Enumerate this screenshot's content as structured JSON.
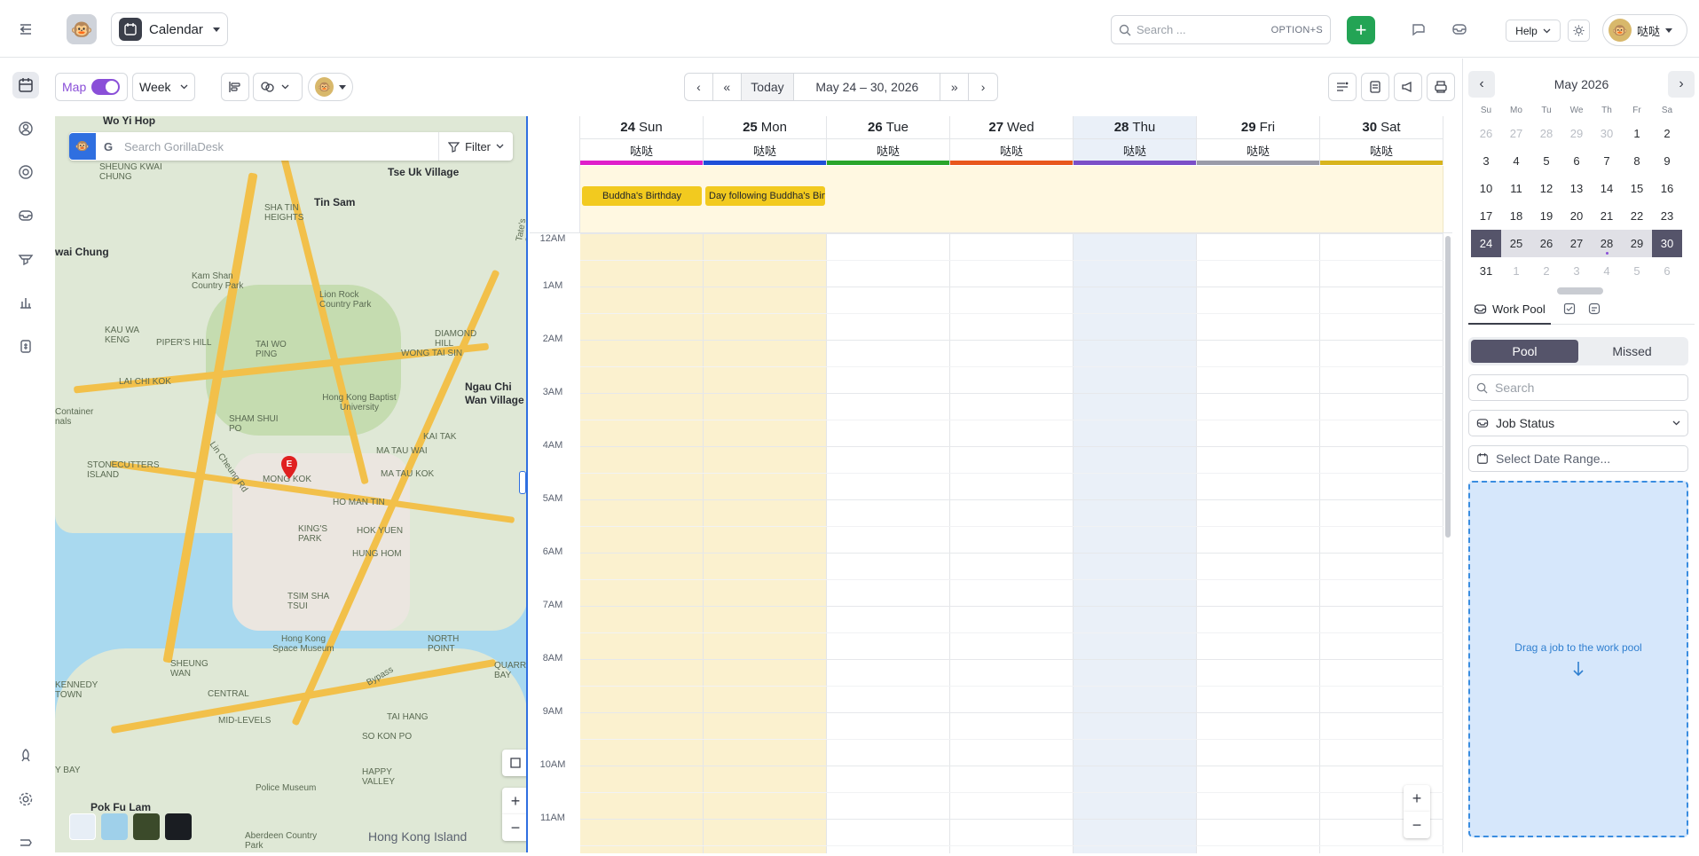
{
  "topbar": {
    "module_label": "Calendar",
    "search_placeholder": "Search ...",
    "search_shortcut": "OPTION+S",
    "help_label": "Help",
    "user_name": "哒哒"
  },
  "toolbar": {
    "map_label": "Map",
    "view_label": "Week",
    "today_label": "Today",
    "date_range": "May 24 – 30, 2026"
  },
  "map": {
    "search_placeholder": "Search GorillaDesk",
    "filter_label": "Filter",
    "pin_label": "E",
    "labels": [
      "Wo Yi Hop",
      "Tse Uk Village",
      "Tin Sam",
      "wai Chung",
      "Ngau Chi Wan Village",
      "Pok Fu Lam",
      "Hong Kong Island",
      "SHEUNG KWAI CHUNG",
      "SHA TIN HEIGHTS",
      "Kam Shan Country Park",
      "Lion Rock Country Park",
      "KAU WA KENG",
      "PIPER'S HILL",
      "TAI WO PING",
      "DIAMOND HILL",
      "WONG TAI SIN",
      "LAI CHI KOK",
      "SHAM SHUI PO",
      "Hong Kong Baptist University",
      "Container nals",
      "MA TAU WAI",
      "KAI TAK",
      "STONECUTTERS ISLAND",
      "Lin Cheung Rd",
      "MONG KOK",
      "HO MAN TIN",
      "MA TAU KOK",
      "KING'S PARK",
      "HOK YUEN",
      "HUNG HOM",
      "TSIM SHA TSUI",
      "Hong Kong Space Museum",
      "SHEUNG WAN",
      "CENTRAL",
      "KENNEDY TOWN",
      "MID-LEVELS",
      "NORTH POINT",
      "QUARRY BAY",
      "TAI HANG",
      "SO KON PO",
      "HAPPY VALLEY",
      "Police Museum",
      "Aberdeen Country Park",
      "Tate's Cairn Tunnel",
      "Bypass",
      "Y BAY"
    ]
  },
  "calendar": {
    "hours": [
      "12AM",
      "1AM",
      "2AM",
      "3AM",
      "4AM",
      "5AM",
      "6AM",
      "7AM",
      "8AM",
      "9AM",
      "10AM",
      "11AM"
    ],
    "days": [
      {
        "num": "24",
        "name": "Sun",
        "tech": "哒哒",
        "color": "#e01ec9"
      },
      {
        "num": "25",
        "name": "Mon",
        "tech": "哒哒",
        "color": "#1e4fd8"
      },
      {
        "num": "26",
        "name": "Tue",
        "tech": "哒哒",
        "color": "#2aa52a"
      },
      {
        "num": "27",
        "name": "Wed",
        "tech": "哒哒",
        "color": "#e8571c"
      },
      {
        "num": "28",
        "name": "Thu",
        "tech": "哒哒",
        "color": "#7b4fc7"
      },
      {
        "num": "29",
        "name": "Fri",
        "tech": "哒哒",
        "color": "#9a9ba8"
      },
      {
        "num": "30",
        "name": "Sat",
        "tech": "哒哒",
        "color": "#d8b41c"
      }
    ],
    "events": [
      {
        "label": "Buddha's Birthday"
      },
      {
        "label": "Day following Buddha's Birthday"
      }
    ]
  },
  "mini_calendar": {
    "title": "May 2026",
    "dow": [
      "Su",
      "Mo",
      "Tu",
      "We",
      "Th",
      "Fr",
      "Sa"
    ],
    "weeks": [
      [
        "26",
        "27",
        "28",
        "29",
        "30",
        "1",
        "2"
      ],
      [
        "3",
        "4",
        "5",
        "6",
        "7",
        "8",
        "9"
      ],
      [
        "10",
        "11",
        "12",
        "13",
        "14",
        "15",
        "16"
      ],
      [
        "17",
        "18",
        "19",
        "20",
        "21",
        "22",
        "23"
      ],
      [
        "24",
        "25",
        "26",
        "27",
        "28",
        "29",
        "30"
      ],
      [
        "31",
        "1",
        "2",
        "3",
        "4",
        "5",
        "6"
      ]
    ]
  },
  "workpool": {
    "tab_label": "Work Pool",
    "pool_label": "Pool",
    "missed_label": "Missed",
    "search_placeholder": "Search",
    "job_status_label": "Job Status",
    "date_range_placeholder": "Select Date Range...",
    "drop_text": "Drag a job to the work pool"
  }
}
